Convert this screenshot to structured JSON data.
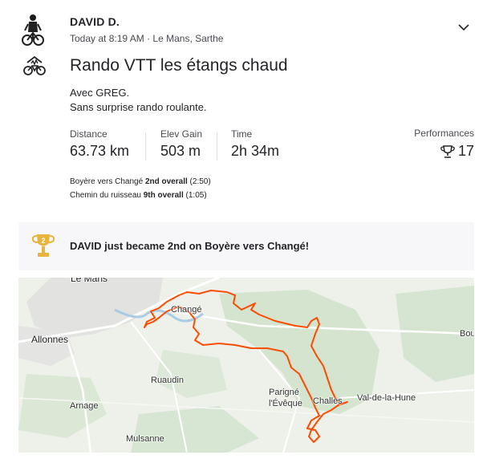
{
  "athlete": {
    "name": "DAVID D.",
    "time": "Today at 8:19 AM",
    "separator": "·",
    "location": "Le Mans, Sarthe"
  },
  "icons": {
    "avatar": "cyclist-photo-avatar",
    "menu": "chevron-down-icon",
    "sport": "e-mountain-bike-icon",
    "performance": "trophy-icon",
    "achievement": "second-place-cup-icon"
  },
  "activity": {
    "title": "Rando VTT les étangs chaud",
    "description_line1": "Avec GREG.",
    "description_line2": "Sans surprise rando roulante."
  },
  "stats": {
    "distance_label": "Distance",
    "distance_value": "63.73 km",
    "elev_label": "Elev Gain",
    "elev_value": "503 m",
    "time_label": "Time",
    "time_value": "2h 34m",
    "perf_label": "Performances",
    "perf_value": "17"
  },
  "segments": [
    {
      "name": "Boyère vers Changé",
      "rank": "2nd overall",
      "time": "(2:50)"
    },
    {
      "name": "Chemin du ruisseau",
      "rank": "9th overall",
      "time": "(1:05)"
    }
  ],
  "achievement": {
    "badge_number": "2",
    "text": "DAVID just became 2nd on Boyère vers Changé!"
  },
  "map": {
    "places": {
      "le_mans": "Le Mans",
      "change": "Changé",
      "allonnes": "Allonnes",
      "ruaudin": "Ruaudin",
      "parigne1": "Parigné",
      "parigne2": "l'Évêque",
      "challes": "Challes",
      "val_de_la_hune": "Val-de-la-Hune",
      "bou": "Bou",
      "arnage": "Arnage",
      "mulsanne": "Mulsanne"
    },
    "route_color": "#fc4c02"
  },
  "colors": {
    "text": "#242428",
    "muted": "#494950",
    "accent": "#fc4c02",
    "trophy_gold": "#e8b43c"
  }
}
